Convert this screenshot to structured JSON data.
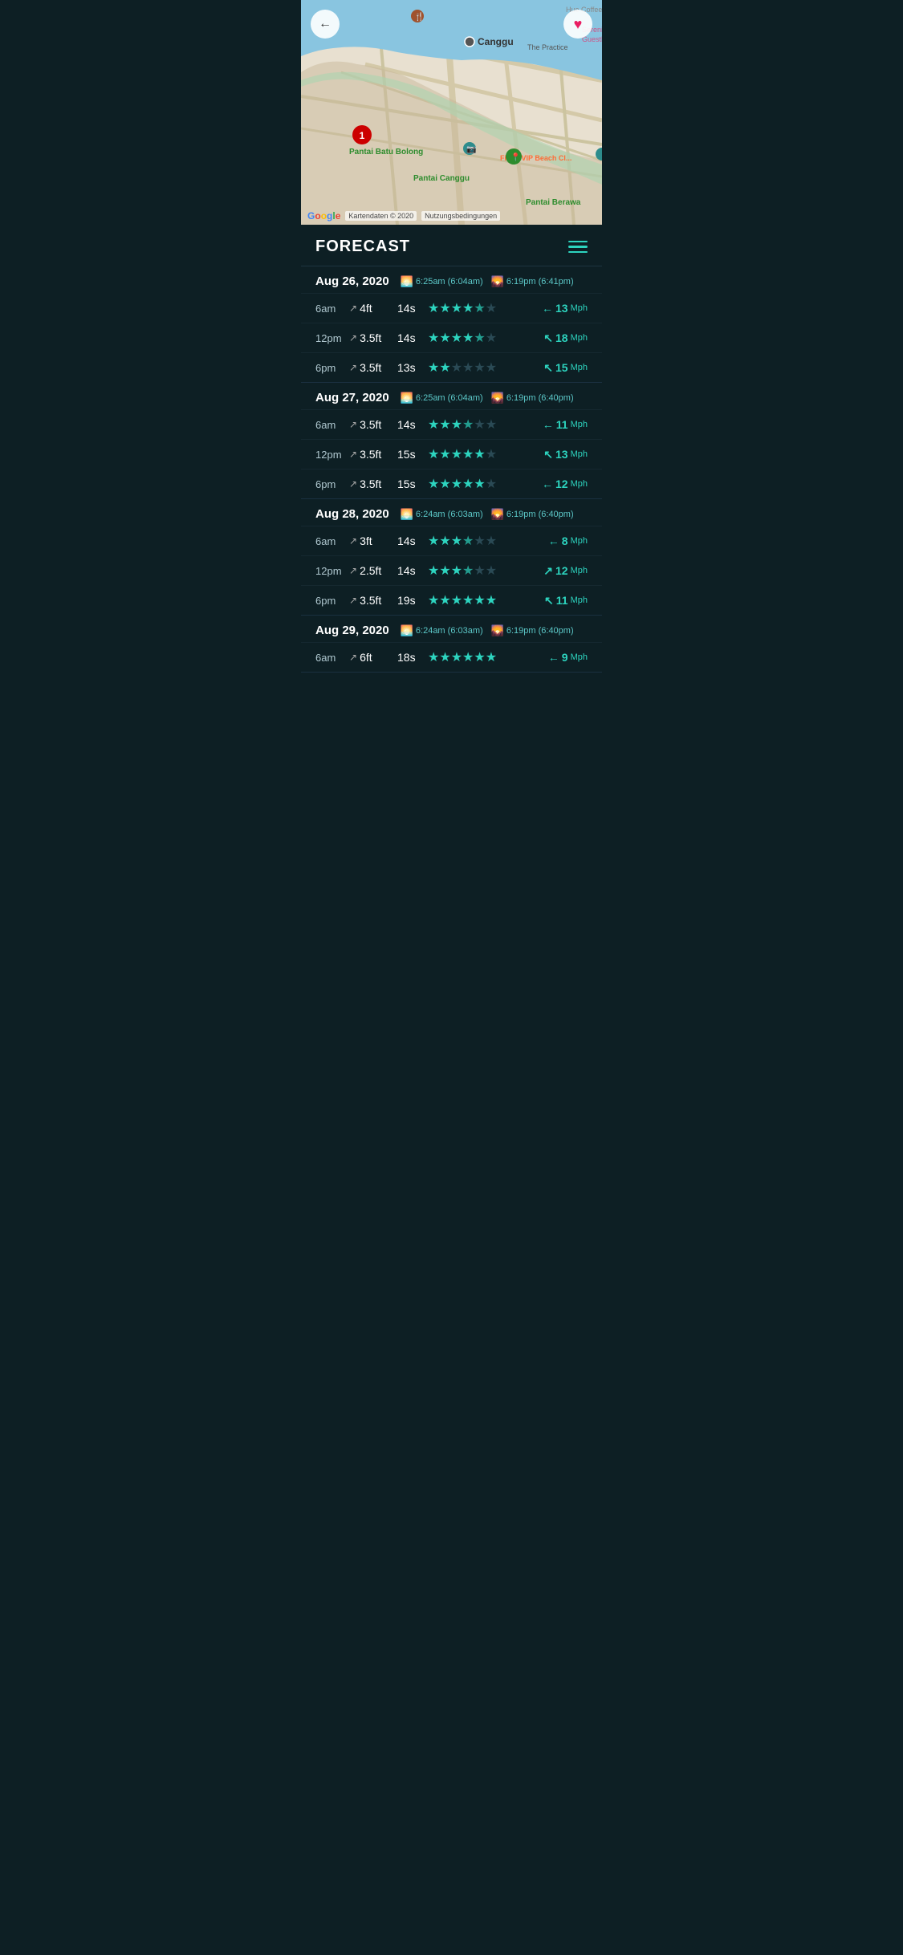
{
  "map": {
    "title": "Canggu",
    "back_icon": "←",
    "favorite_icon": "♥",
    "google_text": "Google",
    "map_data": "Kartendaten © 2020",
    "terms": "Nutzungsbedingungen",
    "places": [
      {
        "name": "Hue Coffee",
        "type": "cafe"
      },
      {
        "name": "Pantai Batu Bolong",
        "type": "beach"
      },
      {
        "name": "Pantai Canggu",
        "type": "beach"
      },
      {
        "name": "Pantai Berawa",
        "type": "beach"
      },
      {
        "name": "Serenity Eco Guesthouse",
        "type": "hotel"
      },
      {
        "name": "Finns VIP Beach Cl...",
        "type": "venue"
      },
      {
        "name": "The Practice",
        "type": "venue"
      }
    ]
  },
  "forecast": {
    "title": "FORECAST",
    "menu_icon": "menu",
    "days": [
      {
        "date": "Aug 26, 2020",
        "sunrise_time": "6:25am",
        "sunrise_real": "6:04am",
        "sunset_time": "6:19pm",
        "sunset_real": "6:41pm",
        "rows": [
          {
            "time": "6am",
            "height": "4ft",
            "period": "14s",
            "stars": [
              1,
              1,
              1,
              1,
              0.5,
              0
            ],
            "wind_speed": "13",
            "wind_dir": "←"
          },
          {
            "time": "12pm",
            "height": "3.5ft",
            "period": "14s",
            "stars": [
              1,
              1,
              1,
              1,
              0.5,
              0
            ],
            "wind_speed": "18",
            "wind_dir": "↖"
          },
          {
            "time": "6pm",
            "height": "3.5ft",
            "period": "13s",
            "stars": [
              1,
              1,
              0,
              0,
              0,
              0
            ],
            "wind_speed": "15",
            "wind_dir": "↖"
          }
        ]
      },
      {
        "date": "Aug 27, 2020",
        "sunrise_time": "6:25am",
        "sunrise_real": "6:04am",
        "sunset_time": "6:19pm",
        "sunset_real": "6:40pm",
        "rows": [
          {
            "time": "6am",
            "height": "3.5ft",
            "period": "14s",
            "stars": [
              1,
              1,
              1,
              0.5,
              0,
              0
            ],
            "wind_speed": "11",
            "wind_dir": "←"
          },
          {
            "time": "12pm",
            "height": "3.5ft",
            "period": "15s",
            "stars": [
              1,
              1,
              1,
              1,
              1,
              0
            ],
            "wind_speed": "13",
            "wind_dir": "↖"
          },
          {
            "time": "6pm",
            "height": "3.5ft",
            "period": "15s",
            "stars": [
              1,
              1,
              1,
              1,
              1,
              0
            ],
            "wind_speed": "12",
            "wind_dir": "←"
          }
        ]
      },
      {
        "date": "Aug 28, 2020",
        "sunrise_time": "6:24am",
        "sunrise_real": "6:03am",
        "sunset_time": "6:19pm",
        "sunset_real": "6:40pm",
        "rows": [
          {
            "time": "6am",
            "height": "3ft",
            "period": "14s",
            "stars": [
              1,
              1,
              1,
              0.5,
              0,
              0
            ],
            "wind_speed": "8",
            "wind_dir": "←"
          },
          {
            "time": "12pm",
            "height": "2.5ft",
            "period": "14s",
            "stars": [
              1,
              1,
              1,
              0.5,
              0,
              0
            ],
            "wind_speed": "12",
            "wind_dir": "↗"
          },
          {
            "time": "6pm",
            "height": "3.5ft",
            "period": "19s",
            "stars": [
              1,
              1,
              1,
              1,
              1,
              1
            ],
            "wind_speed": "11",
            "wind_dir": "↖"
          }
        ]
      },
      {
        "date": "Aug 29, 2020",
        "sunrise_time": "6:24am",
        "sunrise_real": "6:03am",
        "sunset_time": "6:19pm",
        "sunset_real": "6:40pm",
        "rows": [
          {
            "time": "6am",
            "height": "6ft",
            "period": "18s",
            "stars": [
              1,
              1,
              1,
              1,
              1,
              1
            ],
            "wind_speed": "9",
            "wind_dir": "←"
          }
        ]
      }
    ]
  }
}
